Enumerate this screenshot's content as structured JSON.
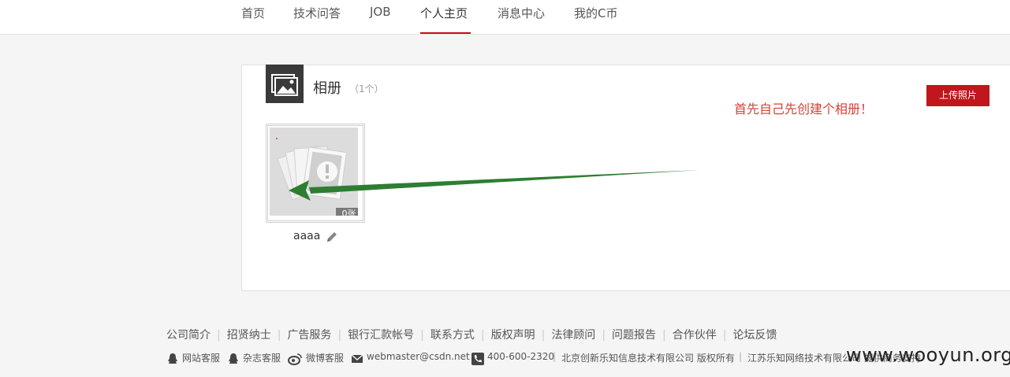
{
  "nav": {
    "items": [
      "首页",
      "技术问答",
      "JOB",
      "个人主页",
      "消息中心",
      "我的C币"
    ],
    "active": "个人主页"
  },
  "album": {
    "section_title": "相册",
    "count_text": "（1个）",
    "upload_label": "上传照片",
    "annotation": "首先自己先创建个相册！",
    "albums": [
      {
        "name": "aaaa",
        "photo_count": "0张"
      }
    ]
  },
  "footer": {
    "links": [
      "公司简介",
      "招贤纳士",
      "广告服务",
      "银行汇款帐号",
      "联系方式",
      "版权声明",
      "法律顾问",
      "问题报告",
      "合作伙伴",
      "论坛反馈"
    ],
    "contact": {
      "site_service": "网站客服",
      "magazine_service": "杂志客服",
      "weibo_service": "微博客服",
      "email": "webmaster@csdn.net",
      "phone": "400-600-2320",
      "company": "北京创新乐知信息技术有限公司 版权所有",
      "company2": "江苏乐知网络技术有限公司 提供商务支持"
    }
  },
  "watermark": "www.wooyun.org",
  "colors": {
    "accent": "#ca0c16",
    "annotation": "#d0453a",
    "arrow": "#2e7d32"
  }
}
